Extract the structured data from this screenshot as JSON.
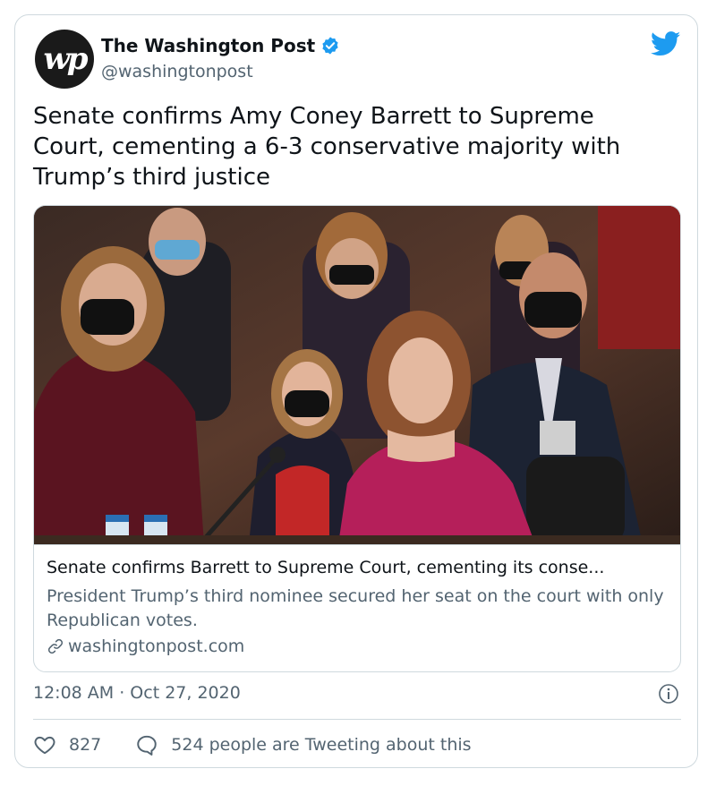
{
  "account": {
    "display_name": "The Washington Post",
    "handle": "@washingtonpost",
    "avatar_text": "wp"
  },
  "tweet": {
    "text": "Senate confirms Amy Coney Barrett to Supreme Court, cementing a 6-3 conservative majority with Trump’s third justice",
    "timestamp": "12:08 AM · Oct 27, 2020"
  },
  "link_card": {
    "title": "Senate confirms Barrett to Supreme Court, cementing its conse...",
    "description": "President Trump’s third nominee secured her seat on the court with only Republican votes.",
    "domain": "washingtonpost.com"
  },
  "actions": {
    "likes": "827",
    "conversation": "524 people are Tweeting about this"
  },
  "icons": [
    "verified-badge-icon",
    "twitter-bird-icon",
    "link-icon",
    "info-icon",
    "heart-icon",
    "speech-bubble-icon"
  ],
  "colors": {
    "accent": "#1d9bf0",
    "text": "#0f1419",
    "secondary_text": "#536471",
    "border": "#cfd9de"
  }
}
